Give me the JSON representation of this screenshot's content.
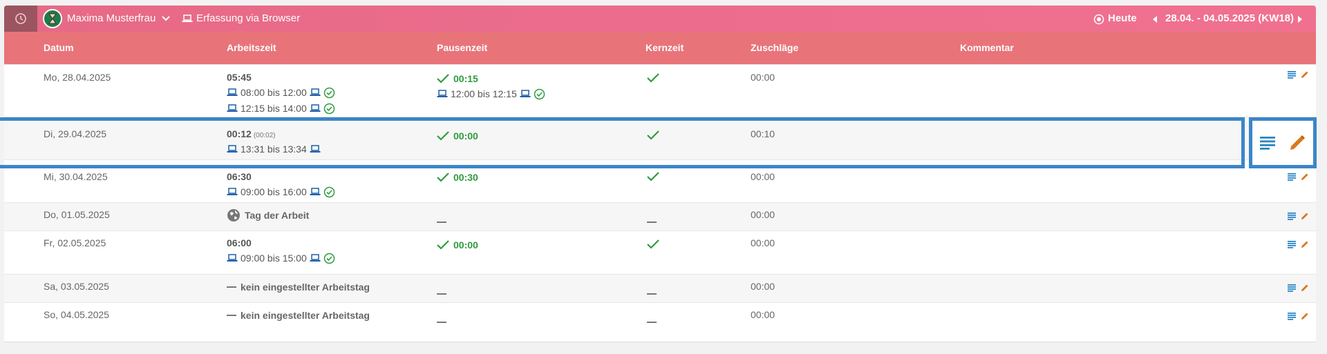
{
  "topbar": {
    "user_name": "Maxima Musterfrau",
    "mode": "Erfassung via Browser",
    "today_label": "Heute",
    "date_range": "28.04. - 04.05.2025 (KW18)"
  },
  "columns": {
    "datum": "Datum",
    "arbeitszeit": "Arbeitszeit",
    "pausenzeit": "Pausenzeit",
    "kernzeit": "Kernzeit",
    "zuschlaege": "Zuschläge",
    "kommentar": "Kommentar"
  },
  "rows": [
    {
      "date": "Mo, 28.04.2025",
      "work_total": "05:45",
      "entries": [
        "08:00 bis 12:00",
        "12:15 bis 14:00"
      ],
      "pause": "00:15",
      "pause_entry": "12:00 bis 12:15",
      "zuschlag": "00:00"
    },
    {
      "date": "Di, 29.04.2025",
      "work_total": "00:12",
      "work_sub": "(00:02)",
      "entries": [
        "13:31 bis 13:34"
      ],
      "pause": "00:00",
      "zuschlag": "00:10"
    },
    {
      "date": "Mi, 30.04.2025",
      "work_total": "06:30",
      "entries": [
        "09:00 bis 16:00"
      ],
      "pause": "00:30",
      "zuschlag": "00:00"
    },
    {
      "date": "Do, 01.05.2025",
      "holiday": "Tag der Arbeit",
      "zuschlag": "00:00"
    },
    {
      "date": "Fr, 02.05.2025",
      "work_total": "06:00",
      "entries": [
        "09:00 bis 15:00"
      ],
      "pause": "00:00",
      "zuschlag": "00:00"
    },
    {
      "date": "Sa, 03.05.2025",
      "no_workday": "kein eingestellter Arbeitstag",
      "zuschlag": "00:00"
    },
    {
      "date": "So, 04.05.2025",
      "no_workday": "kein eingestellter Arbeitstag",
      "zuschlag": "00:00"
    }
  ],
  "colors": {
    "header_gradient_start": "#e66a85",
    "header_gradient_end": "#f0718f",
    "table_header": "#e8747a",
    "check_green": "#2e9b3d",
    "laptop_blue": "#1d5fa8",
    "comment_blue": "#2a86c4",
    "edit_orange": "#d9791a",
    "highlight_blue": "#3b86c9"
  }
}
